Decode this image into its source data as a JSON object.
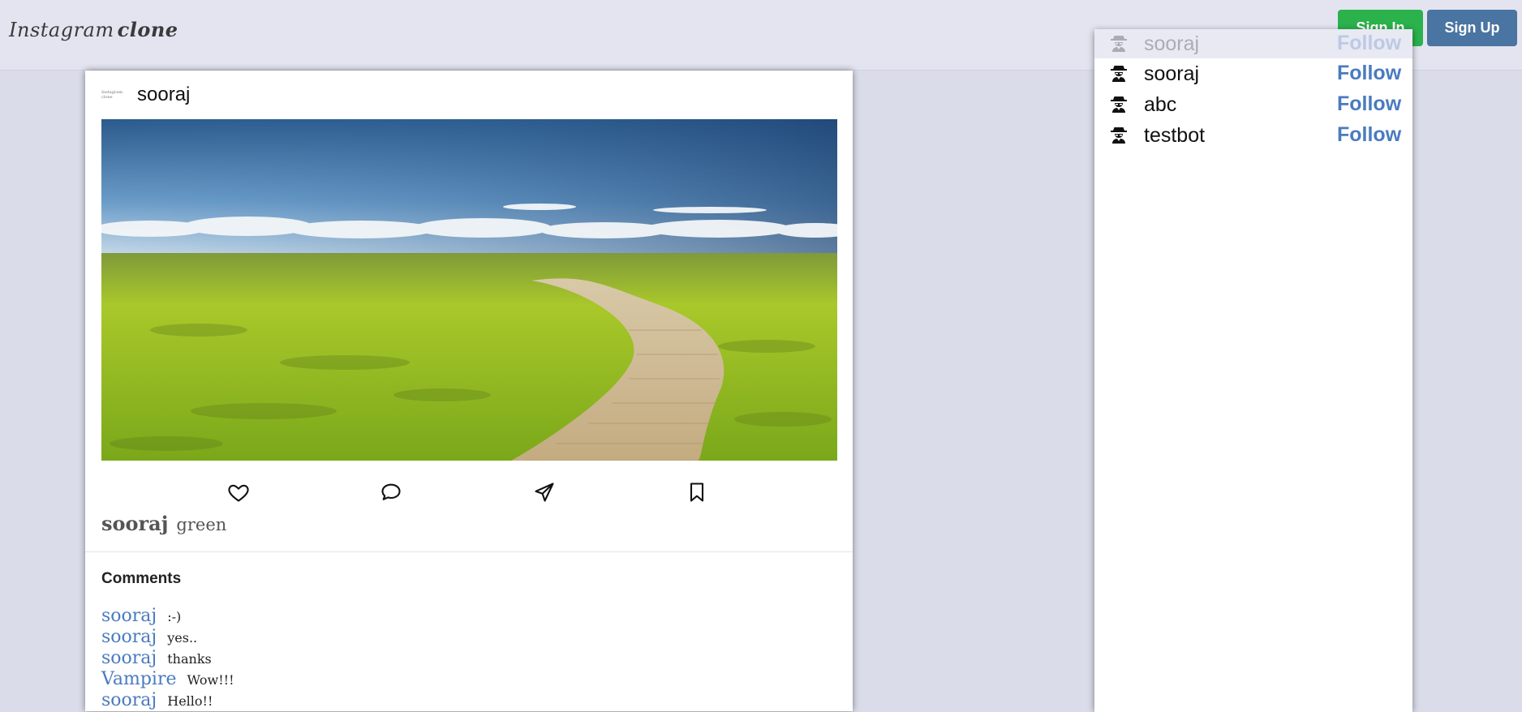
{
  "navbar": {
    "brand_part1": "Instagram",
    "brand_part2": "clone",
    "signin_label": "Sign In",
    "signup_label": "Sign Up"
  },
  "post": {
    "avatar_text": "Instagram clone",
    "username": "sooraj",
    "caption_user": "sooraj",
    "caption_text": "green",
    "actions": [
      "heart-icon",
      "comment-icon",
      "send-icon",
      "bookmark-icon"
    ],
    "comments_title": "Comments",
    "comments": [
      {
        "user": "sooraj",
        "text": ":-)"
      },
      {
        "user": "sooraj",
        "text": "yes.."
      },
      {
        "user": "sooraj",
        "text": "thanks"
      },
      {
        "user": "Vampire",
        "text": "Wow!!!"
      },
      {
        "user": "sooraj",
        "text": "Hello!!"
      }
    ]
  },
  "suggestions": {
    "items": [
      {
        "name": "sooraj",
        "action": "Follow",
        "faded": true
      },
      {
        "name": "sooraj",
        "action": "Follow"
      },
      {
        "name": "abc",
        "action": "Follow"
      },
      {
        "name": "testbot",
        "action": "Follow"
      }
    ]
  },
  "colors": {
    "background": "#dadcea",
    "navbar": "#e3e4f0",
    "signin": "#2bb24c",
    "signup": "#4a74a1",
    "link": "#4a7bbf"
  }
}
